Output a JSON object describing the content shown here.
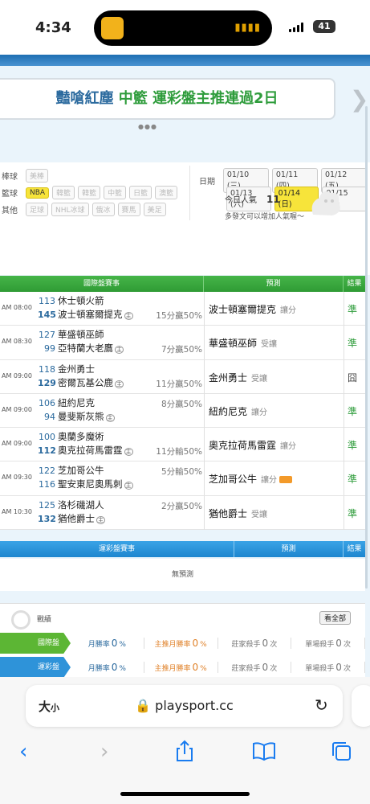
{
  "status": {
    "time": "4:34",
    "battery": "41"
  },
  "banner": {
    "part1": "豔嗆紅塵",
    "part2": "中籃",
    "part3": "運彩盤主推連過2日"
  },
  "filters": {
    "baseball_label": "棒球",
    "baseball_tags": [
      "美棒"
    ],
    "basketball_label": "籃球",
    "basketball_tags": [
      "NBA",
      "韓籃",
      "韓籃",
      "中籃",
      "日籃",
      "澳籃"
    ],
    "other_label": "其他",
    "other_tags": [
      "足球",
      "NHL冰球",
      "俄冰",
      "賽馬",
      "美足"
    ],
    "date_label": "日期",
    "dates": [
      "01/10 (三)",
      "01/11 (四)",
      "01/12 (五)",
      "01/13 (六)",
      "01/14 (日)",
      "01/15 (一)"
    ],
    "selected_date": "01/14 (日)",
    "popularity_label": "今日人氣",
    "popularity_value": "11",
    "hint": "多發文可以增加人氣喔～"
  },
  "intl_table": {
    "col_game": "國際盤賽事",
    "col_pred": "預測",
    "col_result": "結果",
    "rows": [
      {
        "time": "AM 08:00",
        "n1": "113",
        "n2": "145",
        "t1": "休士頓火箭",
        "t2": "波士頓塞爾提克",
        "home": "主",
        "odds": "15分贏50%",
        "odds_row": 2,
        "pred": "波士頓塞爾提克",
        "kind": "讓分",
        "result": "準",
        "ok": true
      },
      {
        "time": "AM 08:30",
        "n1": "127",
        "n2": "99",
        "t1": "華盛頓巫師",
        "t2": "亞特蘭大老鷹",
        "home": "主",
        "odds": "7分贏50%",
        "odds_row": 2,
        "pred": "華盛頓巫師",
        "kind": "受讓",
        "result": "準",
        "ok": true
      },
      {
        "time": "AM 09:00",
        "n1": "118",
        "n2": "129",
        "t1": "金州勇士",
        "t2": "密爾瓦基公鹿",
        "home": "主",
        "odds": "11分贏50%",
        "odds_row": 2,
        "pred": "金州勇士",
        "kind": "受讓",
        "result": "囧",
        "ok": false
      },
      {
        "time": "AM 09:00",
        "n1": "106",
        "n2": "94",
        "t1": "紐約尼克",
        "t2": "曼斐斯灰熊",
        "home": "主",
        "odds": "8分贏50%",
        "odds_row": 1,
        "pred": "紐約尼克",
        "kind": "讓分",
        "result": "準",
        "ok": true
      },
      {
        "time": "AM 09:00",
        "n1": "100",
        "n2": "112",
        "t1": "奧蘭多魔術",
        "t2": "奧克拉荷馬雷霆",
        "home": "主",
        "odds": "11分輸50%",
        "odds_row": 2,
        "pred": "奧克拉荷馬雷霆",
        "kind": "讓分",
        "result": "準",
        "ok": true
      },
      {
        "time": "AM 09:30",
        "n1": "122",
        "n2": "116",
        "t1": "芝加哥公牛",
        "t2": "聖安東尼奧馬刺",
        "home": "主",
        "odds": "5分輸50%",
        "odds_row": 1,
        "pred": "芝加哥公牛",
        "kind": "讓分",
        "result": "準",
        "ok": true,
        "badge": true
      },
      {
        "time": "AM 10:30",
        "n1": "125",
        "n2": "132",
        "t1": "洛杉磯湖人",
        "t2": "猶他爵士",
        "home": "主",
        "odds": "2分贏50%",
        "odds_row": 1,
        "pred": "猶他爵士",
        "kind": "受讓",
        "result": "準",
        "ok": true
      }
    ]
  },
  "lottery_table": {
    "col_game": "運彩盤賽事",
    "col_pred": "預測",
    "col_result": "結果",
    "empty": "無預測"
  },
  "stats": {
    "title": "戰績",
    "all_button": "看全部",
    "rows": [
      {
        "cat": "國際盤",
        "color": "#5cb634"
      },
      {
        "cat": "運彩盤",
        "color": "#2e93d9"
      }
    ],
    "cols": [
      {
        "label": "月勝率",
        "value": "0",
        "unit": "%",
        "color": "#2b6a9e"
      },
      {
        "label": "主推月勝率",
        "value": "0",
        "unit": "%",
        "color": "#e0822a"
      },
      {
        "label": "莊家殺手",
        "value": "0",
        "unit": "次",
        "color": "#777"
      },
      {
        "label": "單場殺手",
        "value": "0",
        "unit": "次",
        "color": "#777"
      }
    ]
  },
  "browser": {
    "text_size": "大",
    "text_size_small": "小",
    "url": "playsport.cc"
  }
}
